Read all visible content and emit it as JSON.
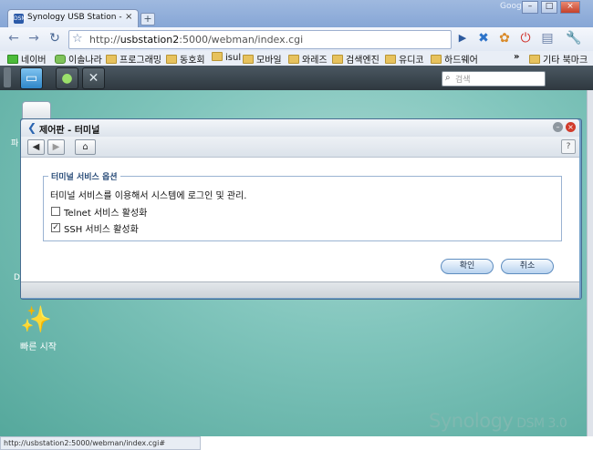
{
  "browser": {
    "tab_favicon": "DSM",
    "tab_title": "Synology USB Station - US...",
    "tab_close": "×",
    "new_tab": "+",
    "brand": "Google",
    "controls": {
      "minimize": "–",
      "maximize": "□",
      "close": "×"
    },
    "url_prefix": "http://",
    "url_host": "usbstation2",
    "url_rest": ":5000/webman/index.cgi",
    "bookmarks": [
      "네이버",
      "이솔나라",
      "프로그래밍",
      "동호회",
      "isul",
      "모바일",
      "와레즈",
      "검색엔진",
      "유디코",
      "하드웨어"
    ],
    "bookmarks_more": "»",
    "bookmarks_other": "기타 북마크",
    "status_url": "http://usbstation2:5000/webman/index.cgi#"
  },
  "dsm": {
    "search_placeholder": "검색",
    "desktop": {
      "icon1_label": "파",
      "icon_partial_label": "D",
      "quickstart_label": "빠른 시작"
    },
    "logo_brand": "Synology",
    "logo_product": " DSM 3.0"
  },
  "dialog": {
    "title": "제어판 - 터미널",
    "help": "?",
    "legend": "터미널 서비스 옵션",
    "description": "터미널 서비스를 이용해서 시스템에 로그인 및 관리.",
    "options": [
      {
        "label": "Telnet 서비스 활성화",
        "checked": false
      },
      {
        "label": "SSH 서비스 활성화",
        "checked": true
      }
    ],
    "ok_label": "확인",
    "cancel_label": "취소"
  },
  "colors": {
    "accent": "#5e8dc0",
    "desktop": "#82c6bd",
    "taskbar": "#3b464d"
  }
}
